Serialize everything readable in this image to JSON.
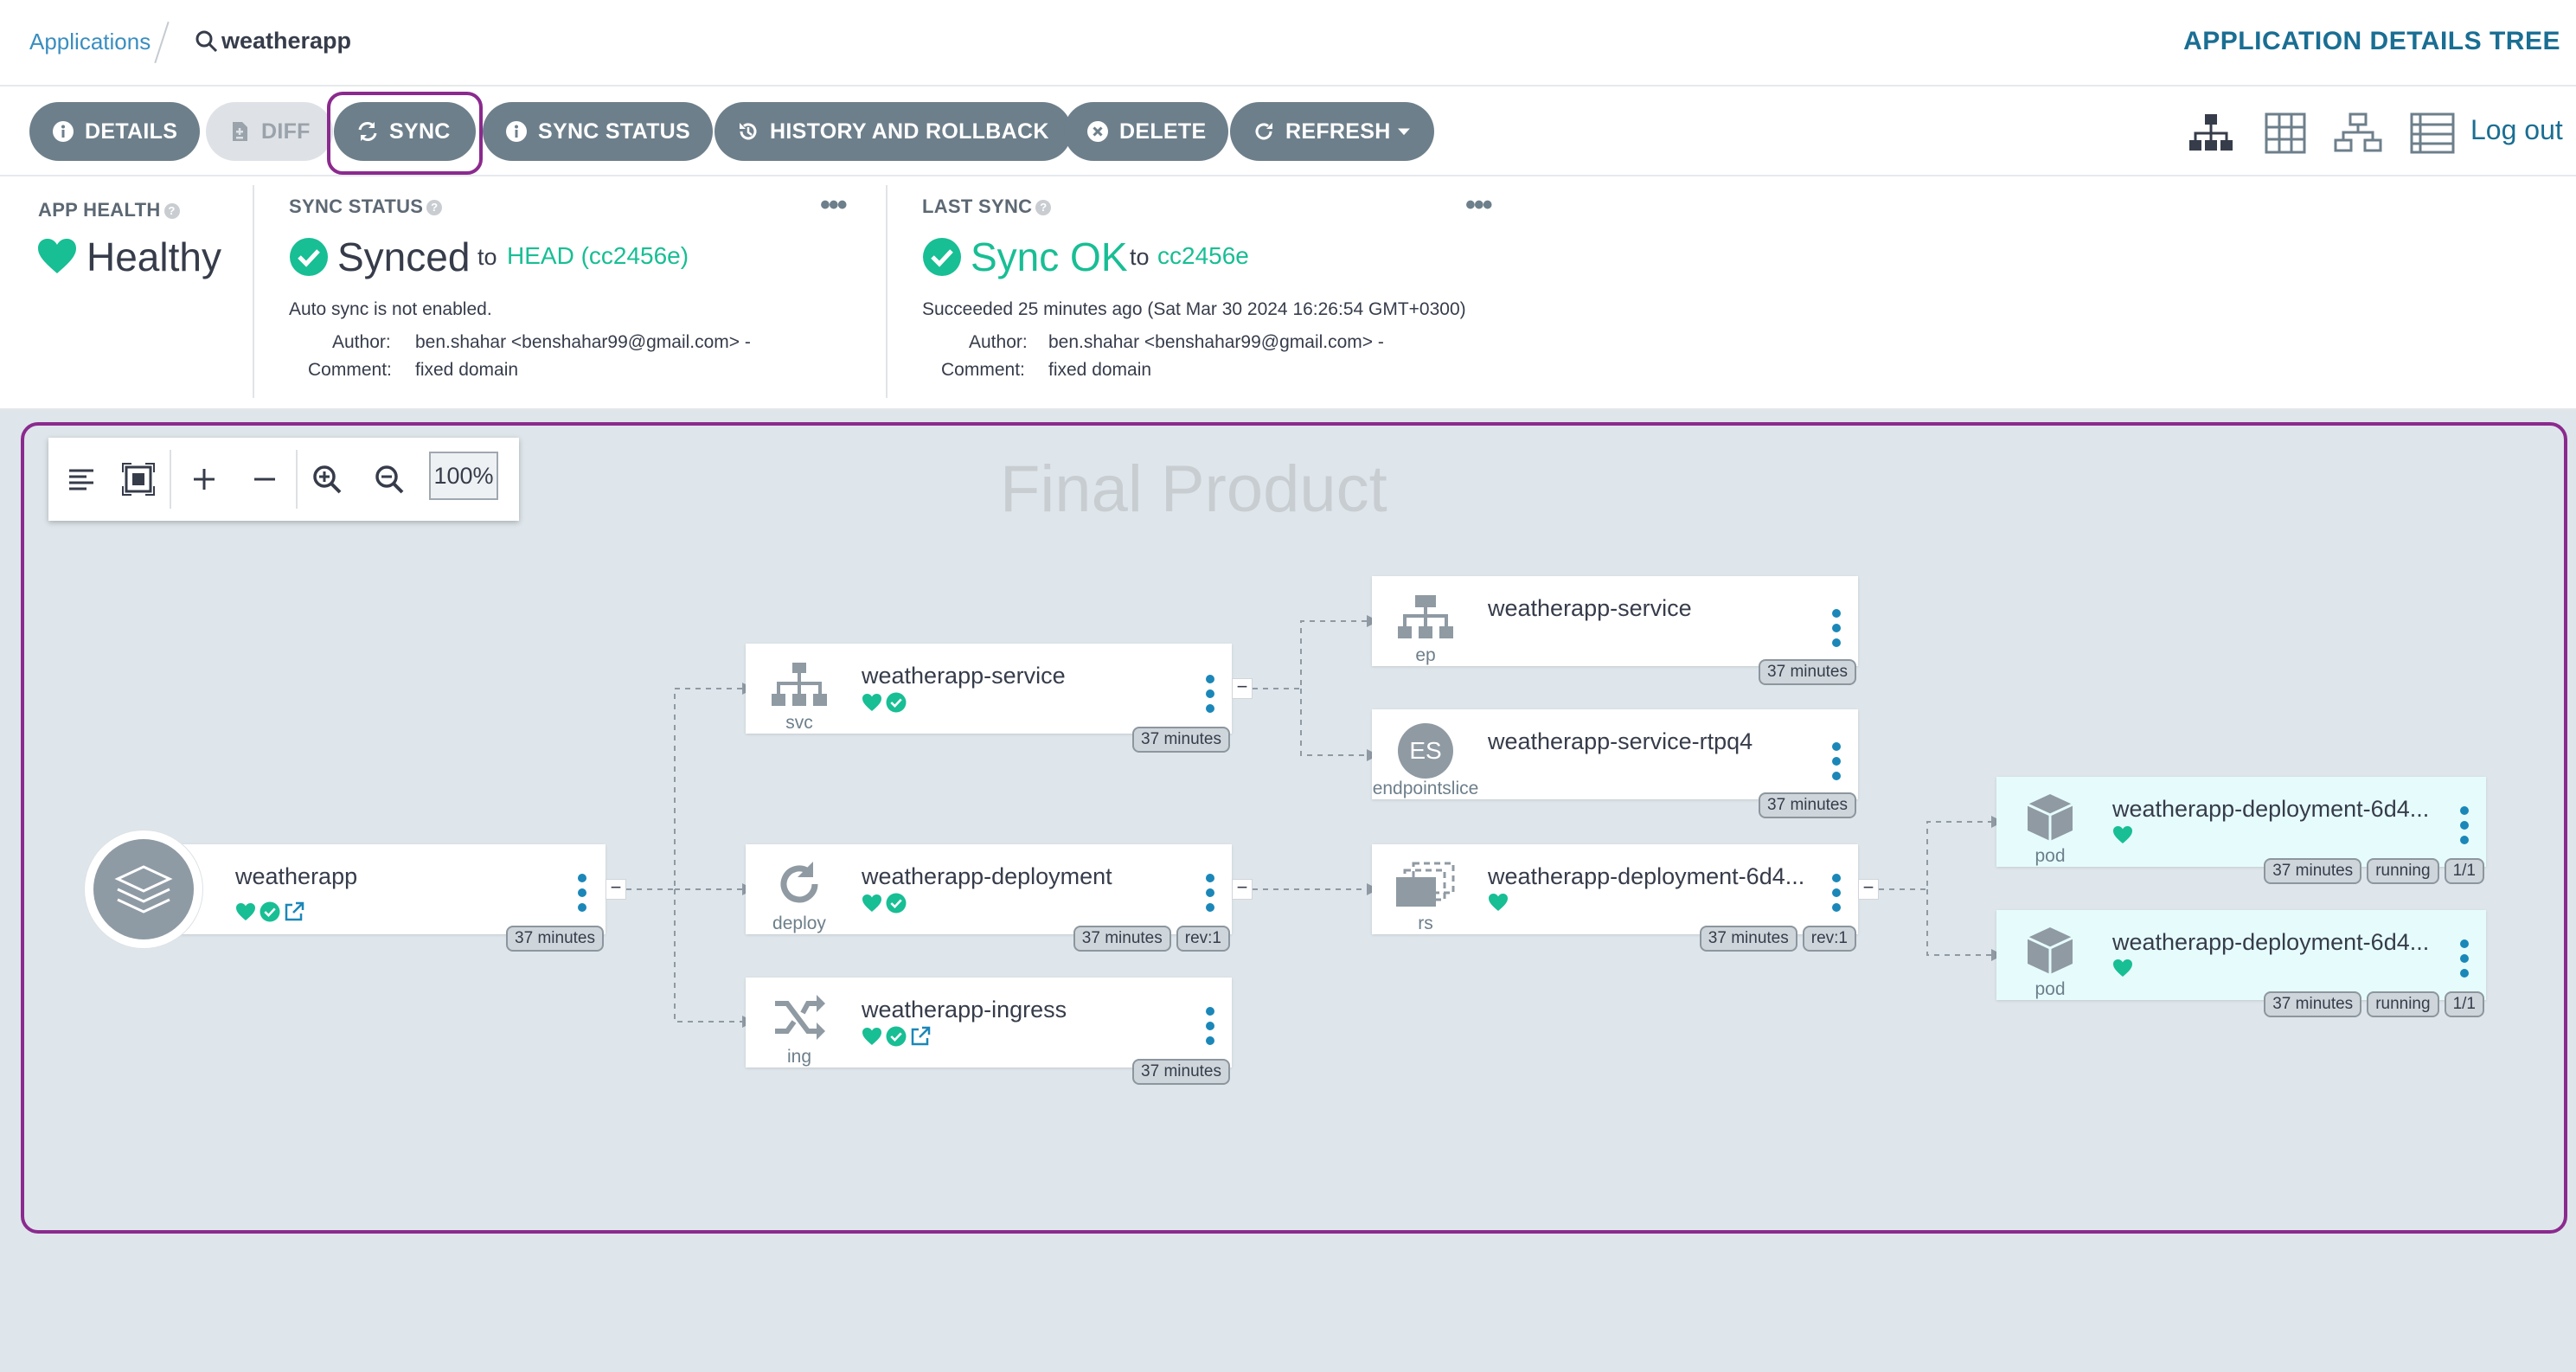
{
  "breadcrumb": {
    "applications": "Applications",
    "app": "weatherapp"
  },
  "page_title": "APPLICATION DETAILS TREE",
  "toolbar": {
    "details": "DETAILS",
    "diff": "DIFF",
    "sync": "SYNC",
    "sync_status": "SYNC STATUS",
    "history": "HISTORY AND ROLLBACK",
    "delete": "DELETE",
    "refresh": "REFRESH",
    "logout": "Log out"
  },
  "status": {
    "app_health": {
      "label": "APP HEALTH",
      "value": "Healthy"
    },
    "sync_status": {
      "label": "SYNC STATUS",
      "value": "Synced",
      "to": "to",
      "revision": "HEAD (cc2456e)",
      "auto_sync": "Auto sync is not enabled.",
      "author_label": "Author:",
      "author": "ben.shahar <benshahar99@gmail.com> -",
      "comment_label": "Comment:",
      "comment": "fixed domain"
    },
    "last_sync": {
      "label": "LAST SYNC",
      "value": "Sync OK",
      "to": "to",
      "revision": "cc2456e",
      "succeeded": "Succeeded 25 minutes ago (Sat Mar 30 2024 16:26:54 GMT+0300)",
      "author_label": "Author:",
      "author": "ben.shahar <benshahar99@gmail.com> -",
      "comment_label": "Comment:",
      "comment": "fixed domain"
    },
    "more": "•••"
  },
  "zoom": {
    "level": "100%"
  },
  "annotation": "Final Product",
  "nodes": {
    "app": {
      "name": "weatherapp",
      "age": "37 minutes"
    },
    "svc": {
      "name": "weatherapp-service",
      "kind": "svc",
      "age": "37 minutes"
    },
    "deploy": {
      "name": "weatherapp-deployment",
      "kind": "deploy",
      "age": "37 minutes",
      "rev": "rev:1"
    },
    "ing": {
      "name": "weatherapp-ingress",
      "kind": "ing",
      "age": "37 minutes"
    },
    "ep": {
      "name": "weatherapp-service",
      "kind": "ep",
      "age": "37 minutes"
    },
    "es": {
      "name": "weatherapp-service-rtpq4",
      "kind": "endpointslice",
      "icon_text": "ES",
      "age": "37 minutes"
    },
    "rs": {
      "name": "weatherapp-deployment-6d4...",
      "kind": "rs",
      "age": "37 minutes",
      "rev": "rev:1"
    },
    "pod1": {
      "name": "weatherapp-deployment-6d4...",
      "kind": "pod",
      "age": "37 minutes",
      "state": "running",
      "ready": "1/1"
    },
    "pod2": {
      "name": "weatherapp-deployment-6d4...",
      "kind": "pod",
      "age": "37 minutes",
      "state": "running",
      "ready": "1/1"
    }
  },
  "colors": {
    "accent": "#8b2a8e",
    "healthy": "#18be94",
    "link": "#1a6e93",
    "button": "#6d7f8b"
  }
}
